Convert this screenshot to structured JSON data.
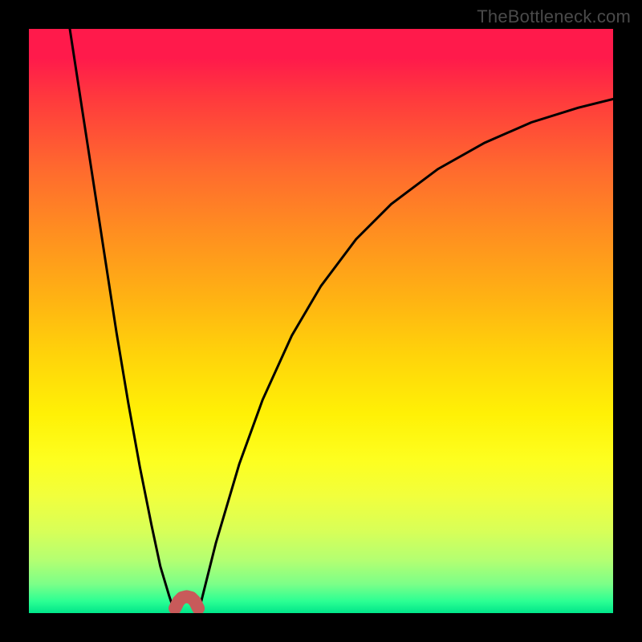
{
  "watermark": "TheBottleneck.com",
  "chart_data": {
    "type": "line",
    "title": "",
    "xlabel": "",
    "ylabel": "",
    "xlim": [
      0,
      1
    ],
    "ylim": [
      0,
      1
    ],
    "series": [
      {
        "name": "left-branch",
        "x": [
          0.07,
          0.09,
          0.11,
          0.13,
          0.15,
          0.17,
          0.19,
          0.21,
          0.225,
          0.24,
          0.25
        ],
        "y": [
          1.0,
          0.87,
          0.74,
          0.61,
          0.48,
          0.36,
          0.25,
          0.15,
          0.08,
          0.03,
          0.0
        ]
      },
      {
        "name": "dip",
        "x": [
          0.25,
          0.256,
          0.262,
          0.27,
          0.278,
          0.284,
          0.29
        ],
        "y": [
          0.0,
          0.012,
          0.018,
          0.02,
          0.018,
          0.012,
          0.0
        ]
      },
      {
        "name": "right-branch",
        "x": [
          0.29,
          0.32,
          0.36,
          0.4,
          0.45,
          0.5,
          0.56,
          0.62,
          0.7,
          0.78,
          0.86,
          0.94,
          1.0
        ],
        "y": [
          0.0,
          0.12,
          0.255,
          0.365,
          0.475,
          0.56,
          0.64,
          0.7,
          0.76,
          0.805,
          0.84,
          0.865,
          0.88
        ]
      }
    ],
    "marker": {
      "name": "highlight-u",
      "x": 0.27,
      "y": 0.01,
      "color": "#c85a5a"
    },
    "gradient_stops": [
      {
        "pos": 0.0,
        "color": "#ff1a4b"
      },
      {
        "pos": 0.5,
        "color": "#ffcf0a"
      },
      {
        "pos": 0.8,
        "color": "#f6ff30"
      },
      {
        "pos": 1.0,
        "color": "#00e58a"
      }
    ]
  }
}
